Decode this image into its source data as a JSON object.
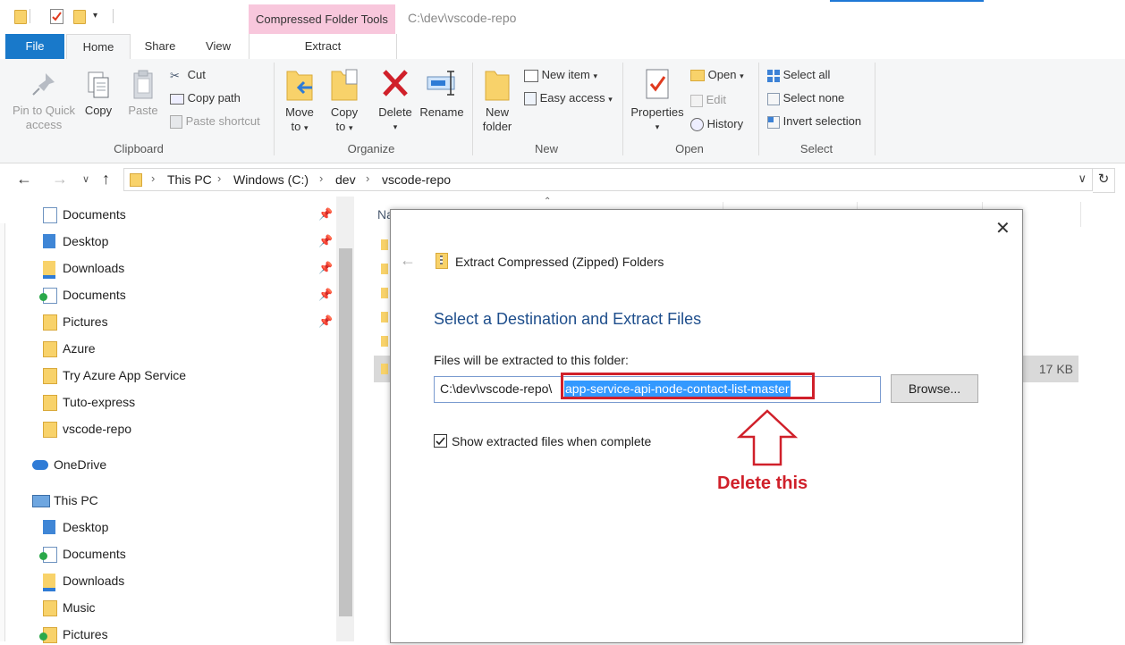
{
  "window": {
    "path_title": "C:\\dev\\vscode-repo",
    "context_tab_group": "Compressed Folder Tools"
  },
  "tabs": {
    "file": "File",
    "home": "Home",
    "share": "Share",
    "view": "View",
    "extract": "Extract"
  },
  "ribbon": {
    "clipboard": {
      "label": "Clipboard",
      "pin": [
        "Pin to Quick",
        "access"
      ],
      "copy": "Copy",
      "paste": "Paste",
      "cut": "Cut",
      "copy_path": "Copy path",
      "paste_shortcut": "Paste shortcut"
    },
    "organize": {
      "label": "Organize",
      "move_to": [
        "Move",
        "to"
      ],
      "copy_to": [
        "Copy",
        "to"
      ],
      "delete": "Delete",
      "rename": "Rename"
    },
    "new": {
      "label": "New",
      "new_folder": [
        "New",
        "folder"
      ],
      "new_item": "New item",
      "easy_access": "Easy access"
    },
    "open": {
      "label": "Open",
      "properties": "Properties",
      "open": "Open",
      "edit": "Edit",
      "history": "History"
    },
    "select": {
      "label": "Select",
      "select_all": "Select all",
      "select_none": "Select none",
      "invert_selection": "Invert selection"
    }
  },
  "address": {
    "crumbs": [
      "This PC",
      "Windows (C:)",
      "dev",
      "vscode-repo"
    ]
  },
  "nav_pane": {
    "quick_access": [
      {
        "label": "Documents",
        "pinned": true
      },
      {
        "label": "Desktop",
        "pinned": true
      },
      {
        "label": "Downloads",
        "pinned": true
      },
      {
        "label": "Documents",
        "pinned": true
      },
      {
        "label": "Pictures",
        "pinned": true
      },
      {
        "label": "Azure",
        "pinned": false
      },
      {
        "label": "Try Azure App Service",
        "pinned": false
      },
      {
        "label": "Tuto-express",
        "pinned": false
      },
      {
        "label": "vscode-repo",
        "pinned": false
      }
    ],
    "onedrive": "OneDrive",
    "this_pc": "This PC",
    "this_pc_items": [
      "Desktop",
      "Documents",
      "Downloads",
      "Music",
      "Pictures"
    ]
  },
  "file_list": {
    "col_name_partial": "Na",
    "selected_size": "17 KB"
  },
  "dialog": {
    "title": "Extract Compressed (Zipped) Folders",
    "heading": "Select a Destination and Extract Files",
    "dest_label": "Files will be extracted to this folder:",
    "dest_prefix": "C:\\dev\\vscode-repo\\",
    "dest_selected": "app-service-api-node-contact-list-master",
    "browse": "Browse...",
    "show_files": "Show extracted files when complete",
    "show_files_checked": true
  },
  "annotation": {
    "text": "Delete this",
    "color": "#d0202a"
  },
  "colors": {
    "file_tab": "#1979ca",
    "context_tab": "#f8c7dc",
    "heading_blue": "#1e4e8c",
    "selection": "#3399ff"
  }
}
